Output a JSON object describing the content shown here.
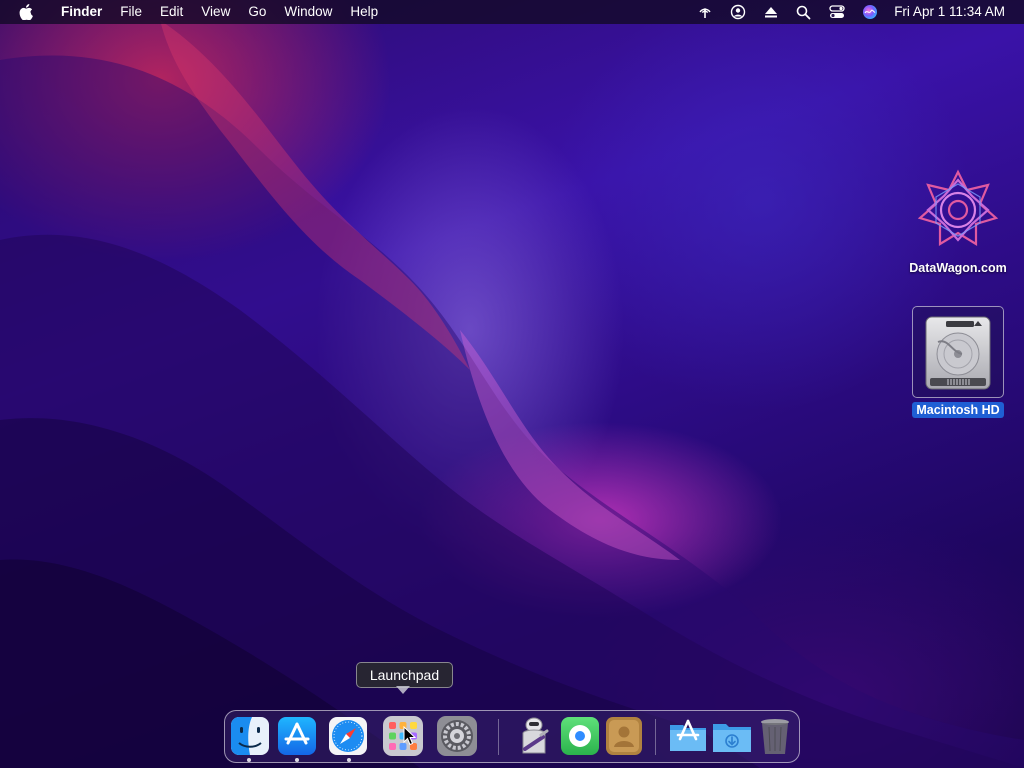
{
  "menubar": {
    "apple_icon": "apple-logo-icon",
    "app_name": "Finder",
    "items": [
      "File",
      "Edit",
      "View",
      "Go",
      "Window",
      "Help"
    ],
    "status_icons": [
      "airdrop-icon",
      "user-account-icon",
      "eject-icon",
      "spotlight-search-icon",
      "control-center-icon",
      "siri-icon"
    ],
    "clock": "Fri Apr 1  11:34 AM"
  },
  "desktop": {
    "icons": [
      {
        "label": "DataWagon.com",
        "icon": "datawagon-logo-icon",
        "selected": false
      },
      {
        "label": "Macintosh HD",
        "icon": "hard-drive-icon",
        "selected": true
      }
    ]
  },
  "tooltip": {
    "text": "Launchpad"
  },
  "dock": {
    "items": [
      {
        "name": "Finder",
        "icon": "finder-icon",
        "running": true
      },
      {
        "name": "App Store",
        "icon": "app-store-icon",
        "running": true
      },
      {
        "name": "Safari",
        "icon": "safari-icon",
        "running": true
      },
      {
        "name": "Launchpad",
        "icon": "launchpad-icon",
        "running": false
      },
      {
        "name": "System Preferences",
        "icon": "system-preferences-icon",
        "running": false
      },
      {
        "name": "Automator",
        "icon": "automator-icon",
        "running": false
      },
      {
        "name": "Find My",
        "icon": "find-my-icon",
        "running": false
      },
      {
        "name": "Contacts",
        "icon": "contacts-icon",
        "running": false
      },
      {
        "name": "Applications",
        "icon": "applications-folder-icon",
        "running": false
      },
      {
        "name": "Downloads",
        "icon": "downloads-folder-icon",
        "running": false
      },
      {
        "name": "Trash",
        "icon": "trash-icon",
        "running": false
      }
    ]
  },
  "colors": {
    "selection_blue": "#1f5fd4",
    "wallpaper_purple": "#3a12a8",
    "wallpaper_magenta": "#c83ccb"
  }
}
